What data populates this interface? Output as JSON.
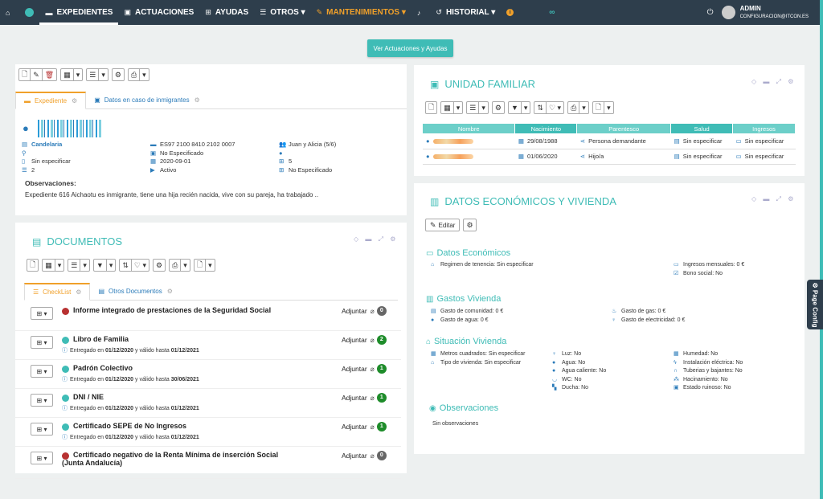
{
  "nav": {
    "items": [
      {
        "label": "EXPEDIENTES",
        "icon": "folder-icon"
      },
      {
        "label": "ACTUACIONES",
        "icon": "calendar-icon"
      },
      {
        "label": "AYUDAS",
        "icon": "plus-square-icon"
      },
      {
        "label": "OTROS ▾",
        "icon": "list-icon"
      },
      {
        "label": "MANTENIMIENTOS ▾",
        "icon": "wrench-icon"
      },
      {
        "label": "HISTORIAL ▾",
        "icon": "history-icon"
      }
    ],
    "user": "ADMIN",
    "email": "configuracion@itcon.es"
  },
  "main_button": "Ver Actuaciones y Ayudas",
  "expediente": {
    "tabs": [
      "Expediente",
      "Datos en caso de inmigrantes"
    ],
    "col1": [
      "Candelaria",
      "",
      "Sin especificar",
      "2"
    ],
    "col2": [
      "ES97 2100 8410 2102 0007",
      "No Especificado",
      "2020-09-01",
      "Activo"
    ],
    "col3": [
      "Juan y Alicia (5/6)",
      "",
      "5",
      "No Especificado"
    ],
    "obs_label": "Observaciones:",
    "obs_text": "Expediente 616 Aichaotu es inmigrante, tiene una hija recién nacida, vive con su pareja, ha trabajado .."
  },
  "documentos": {
    "title": "DOCUMENTOS",
    "tabs": [
      "CheckList",
      "Otros Documentos"
    ],
    "adjuntar": "Adjuntar",
    "rows": [
      {
        "title": "Informe integrado de prestaciones de la Seguridad Social",
        "sub_a": "",
        "date_a": "",
        "sub_b": "",
        "date_b": "",
        "count": "0",
        "status": "red"
      },
      {
        "title": "Libro de Familia",
        "sub_a": "Entregado en",
        "date_a": "01/12/2020",
        "sub_b": "y válido hasta",
        "date_b": "01/12/2021",
        "count": "2",
        "status": "teal"
      },
      {
        "title": "Padrón Colectivo",
        "sub_a": "Entregado en",
        "date_a": "01/12/2020",
        "sub_b": "y válido hasta",
        "date_b": "30/06/2021",
        "count": "1",
        "status": "teal"
      },
      {
        "title": "DNI / NIE",
        "sub_a": "Entregado en",
        "date_a": "01/12/2020",
        "sub_b": "y válido hasta",
        "date_b": "01/12/2021",
        "count": "1",
        "status": "teal"
      },
      {
        "title": "Certificado SEPE de No Ingresos",
        "sub_a": "Entregado en",
        "date_a": "01/12/2020",
        "sub_b": "y válido hasta",
        "date_b": "01/12/2021",
        "count": "1",
        "status": "teal"
      },
      {
        "title": "Certificado negativo de la Renta Mínima de inserción Social",
        "title2": "(Junta Andalucía)",
        "sub_a": "",
        "date_a": "",
        "sub_b": "",
        "date_b": "",
        "count": "0",
        "status": "red"
      }
    ]
  },
  "unidad": {
    "title": "UNIDAD FAMILIAR",
    "headers": [
      "Nombre",
      "Nacimiento",
      "Parentesco",
      "Salud",
      "Ingresos"
    ],
    "rows": [
      {
        "nacimiento": "29/08/1988",
        "parentesco": "Persona demandante",
        "salud": "Sin especificar",
        "ingresos": "Sin especificar"
      },
      {
        "nacimiento": "01/06/2020",
        "parentesco": "Hijo/a",
        "salud": "Sin especificar",
        "ingresos": "Sin especificar"
      }
    ]
  },
  "economicos": {
    "title": "DATOS ECONÓMICOS Y VIVIENDA",
    "edit": "Editar",
    "s1": "Datos Económicos",
    "regimen": "Regimen de tenencia: Sin especificar",
    "ingresos": "Ingresos mensuales: 0 €",
    "bono": "Bono social: No",
    "s2": "Gastos Vivienda",
    "g_com": "Gasto de comunidad: 0 €",
    "g_agua": "Gasto de agua: 0 €",
    "g_gas": "Gasto de gas: 0 €",
    "g_elec": "Gasto de electricidad: 0 €",
    "s3": "Situación Vivienda",
    "v1": [
      "Metros cuadrados: Sin especificar",
      "Tipo de vivienda: Sin especificar"
    ],
    "v2": [
      "Luz: No",
      "Agua: No",
      "Agua caliente: No",
      "WC: No",
      "Ducha: No"
    ],
    "v3": [
      "Humedad: No",
      "Instalación eléctrica: No",
      "Tuberias y bajantes: No",
      "Hacinamiento: No",
      "Estado ruinoso: No"
    ],
    "s4": "Observaciones",
    "obs": "Sin observaciones"
  },
  "page_config": "Page Config",
  "colors": {
    "nav": "#2e3e4c",
    "accent": "#3fbcb6",
    "orange": "#f0a02a",
    "red": "#b83232",
    "green": "#1e8c2a"
  }
}
